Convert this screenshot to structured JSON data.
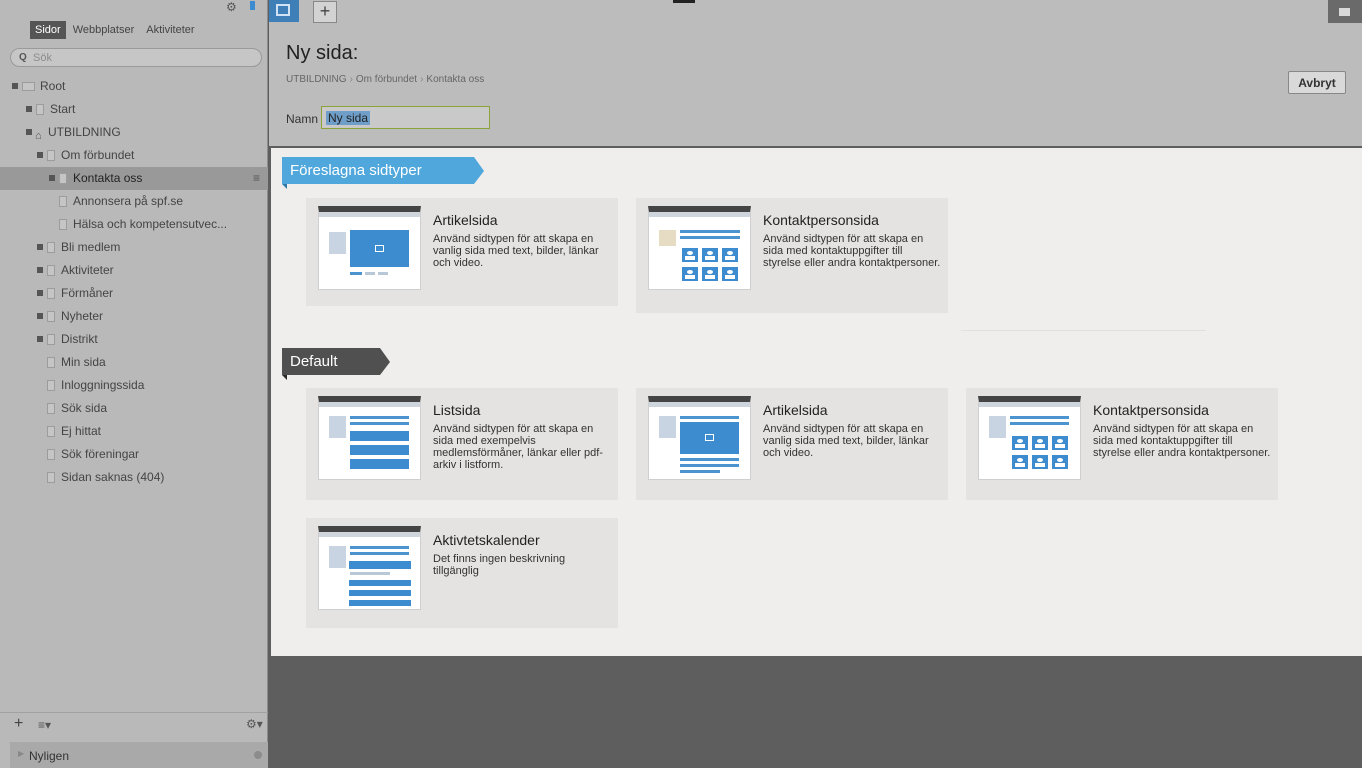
{
  "sidebar": {
    "tabs": [
      "Sidor",
      "Webbplatser",
      "Aktiviteter"
    ],
    "search_placeholder": "Sök",
    "tree": [
      {
        "label": "Root",
        "expandable": true
      },
      {
        "label": "Start",
        "expandable": true
      },
      {
        "label": "UTBILDNING",
        "expandable": true
      },
      {
        "label": "Om förbundet",
        "expandable": true
      },
      {
        "label": "Kontakta oss",
        "expandable": true
      },
      {
        "label": "Annonsera på spf.se",
        "expandable": false
      },
      {
        "label": "Hälsa och kompetensutvec...",
        "expandable": false
      },
      {
        "label": "Bli medlem",
        "expandable": true
      },
      {
        "label": "Aktiviteter",
        "expandable": true
      },
      {
        "label": "Förmåner",
        "expandable": true
      },
      {
        "label": "Nyheter",
        "expandable": true
      },
      {
        "label": "Distrikt",
        "expandable": true
      },
      {
        "label": "Min sida",
        "expandable": false
      },
      {
        "label": "Inloggningssida",
        "expandable": false
      },
      {
        "label": "Sök sida",
        "expandable": false
      },
      {
        "label": "Ej hittat",
        "expandable": false
      },
      {
        "label": "Sök föreningar",
        "expandable": false
      },
      {
        "label": "Sidan saknas (404)",
        "expandable": false
      }
    ],
    "recent_label": "Nyligen"
  },
  "header": {
    "title": "Ny sida:",
    "breadcrumb": [
      "UTBILDNING",
      "Om förbundet",
      "Kontakta oss"
    ],
    "cancel_label": "Avbryt",
    "name_label": "Namn",
    "name_value": "Ny sida"
  },
  "sections": {
    "suggested": {
      "title": "Föreslagna sidtyper",
      "cards": [
        {
          "title": "Artikelsida",
          "description": "Använd sidtypen för att skapa en vanlig sida med text, bilder, länkar och video.",
          "thumb": "article"
        },
        {
          "title": "Kontaktpersonsida",
          "description": "Använd sidtypen för att skapa en sida med kontaktuppgifter till styrelse eller andra kontaktpersoner.",
          "thumb": "contact"
        }
      ]
    },
    "default": {
      "title": "Default",
      "cards": [
        {
          "title": "Listsida",
          "description": "Använd sidtypen för att skapa en sida med exempelvis medlemsförmåner, länkar eller pdf-arkiv i listform.",
          "thumb": "list"
        },
        {
          "title": "Artikelsida",
          "description": "Använd sidtypen för att skapa en vanlig sida med text, bilder, länkar och video.",
          "thumb": "article"
        },
        {
          "title": "Kontaktpersonsida",
          "description": "Använd sidtypen för att skapa en sida med kontaktuppgifter till styrelse eller andra kontaktpersoner.",
          "thumb": "contact"
        },
        {
          "title": "Aktivtetskalender",
          "description": "Det finns ingen beskrivning tillgänglig",
          "thumb": "calendar"
        }
      ]
    }
  },
  "colors": {
    "accent_blue": "#4fa7dc",
    "default_ribbon": "#505050",
    "panel_bg": "#efeeec"
  },
  "icons": [
    "gear-icon",
    "pin-icon",
    "search-icon",
    "page-icon",
    "home-icon",
    "list-menu-icon",
    "plus-icon",
    "folder-icon",
    "structure-icon"
  ]
}
